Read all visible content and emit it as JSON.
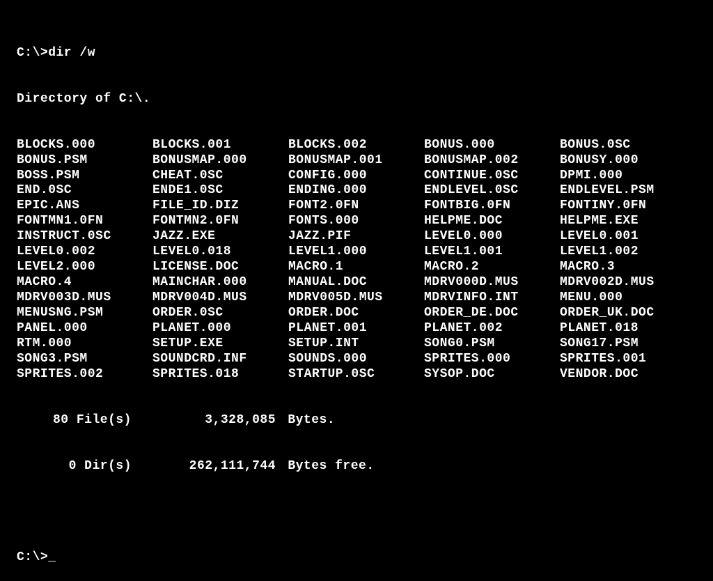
{
  "prompt_line": "C:\\>dir /w",
  "header": "Directory of C:\\.",
  "files": [
    [
      "BLOCKS.000",
      "BLOCKS.001",
      "BLOCKS.002",
      "BONUS.000",
      "BONUS.0SC"
    ],
    [
      "BONUS.PSM",
      "BONUSMAP.000",
      "BONUSMAP.001",
      "BONUSMAP.002",
      "BONUSY.000"
    ],
    [
      "BOSS.PSM",
      "CHEAT.0SC",
      "CONFIG.000",
      "CONTINUE.0SC",
      "DPMI.000"
    ],
    [
      "END.0SC",
      "ENDE1.0SC",
      "ENDING.000",
      "ENDLEVEL.0SC",
      "ENDLEVEL.PSM"
    ],
    [
      "EPIC.ANS",
      "FILE_ID.DIZ",
      "FONT2.0FN",
      "FONTBIG.0FN",
      "FONTINY.0FN"
    ],
    [
      "FONTMN1.0FN",
      "FONTMN2.0FN",
      "FONTS.000",
      "HELPME.DOC",
      "HELPME.EXE"
    ],
    [
      "INSTRUCT.0SC",
      "JAZZ.EXE",
      "JAZZ.PIF",
      "LEVEL0.000",
      "LEVEL0.001"
    ],
    [
      "LEVEL0.002",
      "LEVEL0.018",
      "LEVEL1.000",
      "LEVEL1.001",
      "LEVEL1.002"
    ],
    [
      "LEVEL2.000",
      "LICENSE.DOC",
      "MACRO.1",
      "MACRO.2",
      "MACRO.3"
    ],
    [
      "MACRO.4",
      "MAINCHAR.000",
      "MANUAL.DOC",
      "MDRV000D.MUS",
      "MDRV002D.MUS"
    ],
    [
      "MDRV003D.MUS",
      "MDRV004D.MUS",
      "MDRV005D.MUS",
      "MDRVINFO.INT",
      "MENU.000"
    ],
    [
      "MENUSNG.PSM",
      "ORDER.0SC",
      "ORDER.DOC",
      "ORDER_DE.DOC",
      "ORDER_UK.DOC"
    ],
    [
      "PANEL.000",
      "PLANET.000",
      "PLANET.001",
      "PLANET.002",
      "PLANET.018"
    ],
    [
      "RTM.000",
      "SETUP.EXE",
      "SETUP.INT",
      "SONG0.PSM",
      "SONG17.PSM"
    ],
    [
      "SONG3.PSM",
      "SOUNDCRD.INF",
      "SOUNDS.000",
      "SPRITES.000",
      "SPRITES.001"
    ],
    [
      "SPRITES.002",
      "SPRITES.018",
      "STARTUP.0SC",
      "SYSOP.DOC",
      "VENDOR.DOC"
    ]
  ],
  "summary": {
    "file_count_label": "80 File(s)",
    "bytes_used": "3,328,085",
    "bytes_label": "Bytes.",
    "dir_count_label": "0 Dir(s)",
    "bytes_free": "262,111,744",
    "bytes_free_label": "Bytes free."
  },
  "next_prompt": "C:\\>",
  "cursor": "_"
}
